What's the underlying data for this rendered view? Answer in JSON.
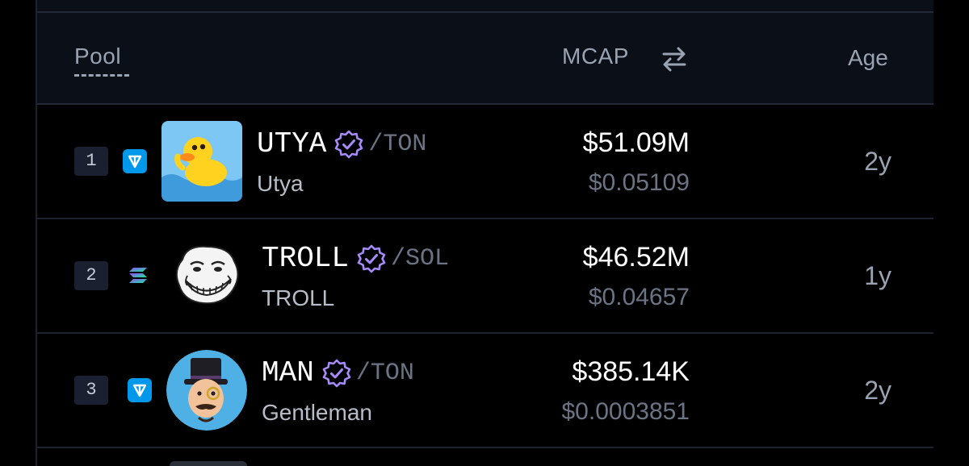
{
  "header": {
    "pool": "Pool",
    "mcap": "MCAP",
    "age": "Age",
    "swap_icon": "swap-arrows-icon"
  },
  "colors": {
    "background": "#000000",
    "header_bg": "#0b0f18",
    "rank_bg": "#1a2030",
    "verified": "#a78bfa",
    "ton": "#0098ea",
    "muted_text": "#6b7485"
  },
  "rows": [
    {
      "rank": "1",
      "chain": "ton",
      "chain_icon": "ton-icon",
      "token_icon": "duck-icon",
      "symbol": "UTYA",
      "quote": "/TON",
      "name": "Utya",
      "mcap": "$51.09M",
      "price": "$0.05109",
      "age": "2y"
    },
    {
      "rank": "2",
      "chain": "sol",
      "chain_icon": "solana-icon",
      "token_icon": "trollface-icon",
      "symbol": "TROLL",
      "quote": "/SOL",
      "name": "TROLL",
      "mcap": "$46.52M",
      "price": "$0.04657",
      "age": "1y"
    },
    {
      "rank": "3",
      "chain": "ton",
      "chain_icon": "ton-icon",
      "token_icon": "gentleman-icon",
      "symbol": "MAN",
      "quote": "/TON",
      "name": "Gentleman",
      "mcap": "$385.14K",
      "price": "$0.0003851",
      "age": "2y"
    }
  ]
}
